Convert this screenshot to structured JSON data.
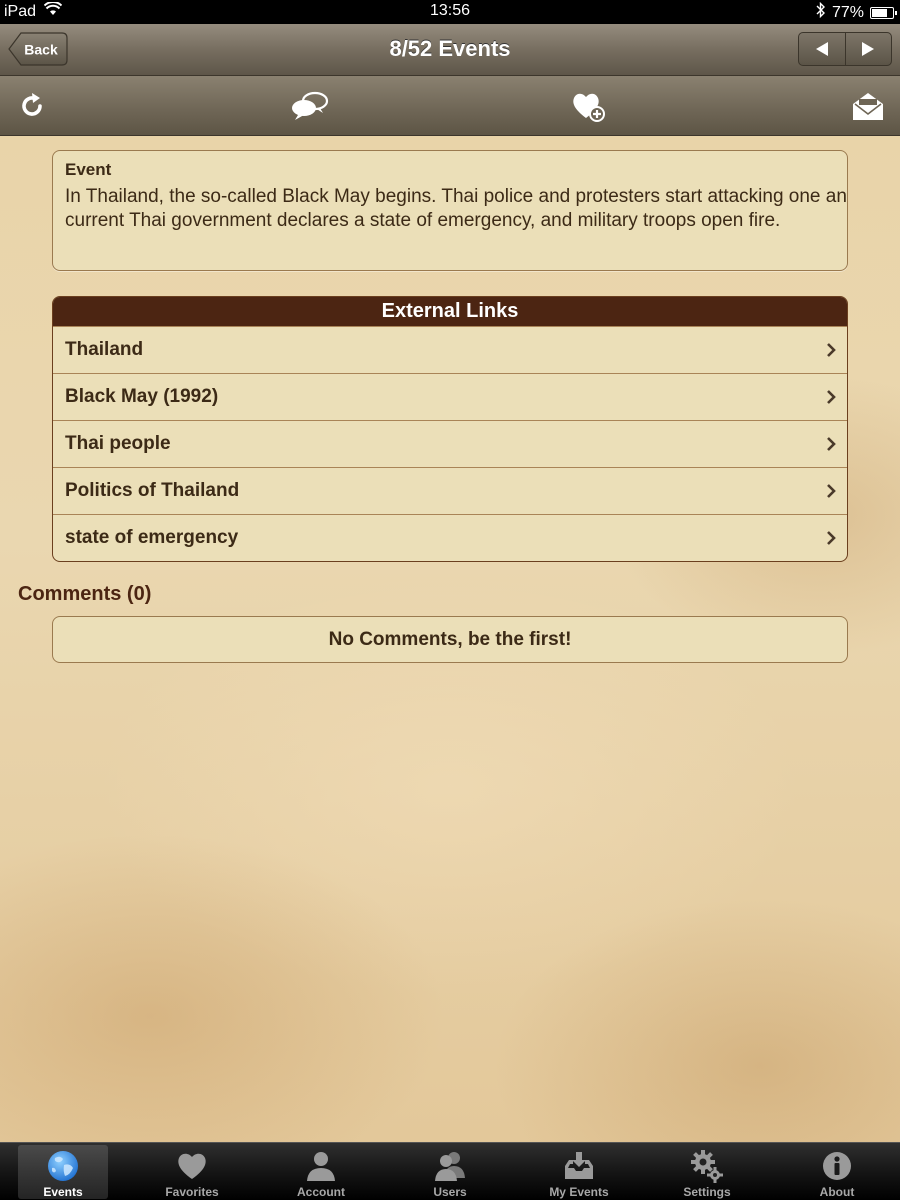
{
  "status": {
    "device": "iPad",
    "time": "13:56",
    "battery": "77%",
    "battery_level": 0.77
  },
  "nav": {
    "back_label": "Back",
    "title": "8/52 Events"
  },
  "toolbar": {
    "icons": [
      "refresh-icon",
      "comment-bubbles-icon",
      "favorite-add-icon",
      "mail-icon"
    ]
  },
  "event": {
    "label": "Event",
    "text_line1": "In Thailand, the so-called Black May begins. Thai police and protesters start attacking one an",
    "text_line2": "current Thai government declares a state of emergency, and military troops open fire."
  },
  "links": {
    "header": "External Links",
    "items": [
      "Thailand",
      "Black May (1992)",
      "Thai people",
      "Politics of Thailand",
      "state of emergency"
    ]
  },
  "comments": {
    "title": "Comments (0)",
    "empty_label": "No Comments, be the first!"
  },
  "tabs": [
    {
      "label": "Events",
      "icon": "globe-icon",
      "active": true
    },
    {
      "label": "Favorites",
      "icon": "heart-icon",
      "active": false
    },
    {
      "label": "Account",
      "icon": "person-icon",
      "active": false
    },
    {
      "label": "Users",
      "icon": "people-icon",
      "active": false
    },
    {
      "label": "My Events",
      "icon": "inbox-download-icon",
      "active": false
    },
    {
      "label": "Settings",
      "icon": "gears-icon",
      "active": false
    },
    {
      "label": "About",
      "icon": "info-icon",
      "active": false
    }
  ]
}
